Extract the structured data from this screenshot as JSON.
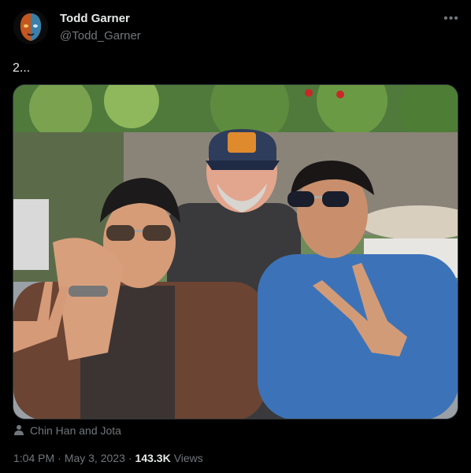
{
  "author": {
    "name": "Todd Garner",
    "handle": "@Todd_Garner"
  },
  "more_icon": "more-horizontal-icon",
  "tweet": {
    "text": "2..."
  },
  "tagged": {
    "icon": "person-icon",
    "names": "Chin Han and Jota"
  },
  "meta": {
    "time": "1:04 PM",
    "separator1": "·",
    "date": "May 3, 2023",
    "separator2": "·",
    "views_count": "143.3K",
    "views_label": "Views"
  }
}
